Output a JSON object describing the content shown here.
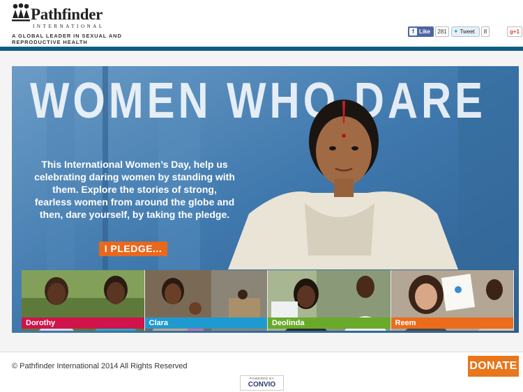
{
  "header": {
    "logo_name": "Pathfinder",
    "logo_sub": "INTERNATIONAL",
    "tagline": "A GLOBAL LEADER IN SEXUAL AND REPRODUCTIVE HEALTH"
  },
  "social": {
    "fb_icon": "f",
    "fb_label": "Like",
    "fb_count": "281",
    "tw_label": "Tweet",
    "tw_count": "8",
    "gplus_label": "g+1"
  },
  "hero": {
    "title": "WOMEN WHO DARE",
    "text": "This International Women’s Day, help us celebrating daring women by standing with them. Explore the stories of strong, fearless women from around the globe and then, dare yourself, by taking the pledge.",
    "button": "I PLEDGE..."
  },
  "stories": [
    {
      "name": "Dorothy",
      "color": "#d0134a"
    },
    {
      "name": "Clara",
      "color": "#1f9ad0"
    },
    {
      "name": "Deolinda",
      "color": "#6aaa2a"
    },
    {
      "name": "Reem",
      "color": "#ea6c1c"
    }
  ],
  "footer": {
    "copyright": "© Pathfinder International 2014 All Rights Reserved",
    "donate": "DONATE",
    "powered_by": "POWERED BY",
    "convio": "CONVIO"
  },
  "colors": {
    "header_bar": "#0f5d87",
    "accent_orange": "#e8761c"
  }
}
